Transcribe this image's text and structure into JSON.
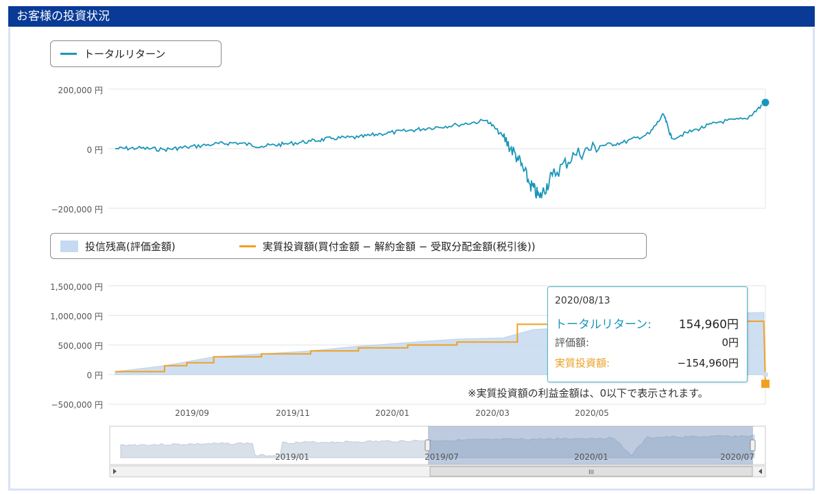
{
  "header": {
    "title": "お客様の投資状況"
  },
  "legend_top": {
    "item": "トータルリターン",
    "color": "#1a96b8"
  },
  "legend_bottom": {
    "item1": "投信残高(評価金額)",
    "item1_color": "#c5daf0",
    "item2": "実質投資額(買付金額 − 解約金額 − 受取分配金額(税引後))",
    "item2_color": "#f0a020"
  },
  "tooltip": {
    "date": "2020/08/13",
    "r1_label": "トータルリターン:",
    "r1_value": "154,960円",
    "r2_label": "評価額:",
    "r2_value": "0円",
    "r3_label": "実質投資額:",
    "r3_value": "−154,960円"
  },
  "note": "※実質投資額の利益金額は、0以下で表示されます。",
  "navigator": {
    "labels": [
      "2019/01",
      "2019/07",
      "2020/01",
      "2020/07"
    ],
    "scroll_grip": "III"
  },
  "chart_data": [
    {
      "type": "line",
      "series": [
        {
          "name": "トータルリターン",
          "x": [
            "2019/07/01",
            "2019/07/15",
            "2019/08/01",
            "2019/08/15",
            "2019/09/01",
            "2019/09/15",
            "2019/10/01",
            "2019/10/15",
            "2019/11/01",
            "2019/11/15",
            "2019/12/01",
            "2019/12/15",
            "2020/01/01",
            "2020/01/15",
            "2020/02/01",
            "2020/02/20",
            "2020/03/01",
            "2020/03/10",
            "2020/03/18",
            "2020/03/24",
            "2020/04/01",
            "2020/04/15",
            "2020/05/01",
            "2020/05/15",
            "2020/06/01",
            "2020/06/10",
            "2020/06/15",
            "2020/07/01",
            "2020/07/15",
            "2020/08/01",
            "2020/08/13"
          ],
          "values": [
            0,
            2000,
            -3000,
            5000,
            15000,
            20000,
            8000,
            15000,
            25000,
            35000,
            38000,
            50000,
            60000,
            70000,
            80000,
            95000,
            40000,
            -30000,
            -120000,
            -165000,
            -90000,
            -20000,
            10000,
            20000,
            50000,
            115000,
            35000,
            65000,
            90000,
            100000,
            154960
          ]
        }
      ],
      "yticks": [
        "200,000 円",
        "0 円",
        "−200,000 円"
      ],
      "ylim": [
        -200000,
        200000
      ]
    },
    {
      "type": "area",
      "series": [
        {
          "name": "投信残高(評価金額)",
          "x": [
            "2019/07/01",
            "2019/08/01",
            "2019/09/01",
            "2019/10/01",
            "2019/11/01",
            "2019/12/01",
            "2020/01/01",
            "2020/02/01",
            "2020/03/01",
            "2020/03/20",
            "2020/04/01",
            "2020/05/01",
            "2020/06/01",
            "2020/07/01",
            "2020/08/01",
            "2020/08/12",
            "2020/08/13"
          ],
          "values": [
            50000,
            150000,
            300000,
            350000,
            400000,
            480000,
            540000,
            600000,
            620000,
            760000,
            780000,
            860000,
            930000,
            1000000,
            1040000,
            1050000,
            0
          ]
        },
        {
          "name": "実質投資額(買付金額 − 解約金額 − 受取分配金額(税引後))",
          "x": [
            "2019/07/01",
            "2019/08/01",
            "2019/08/15",
            "2019/09/01",
            "2019/10/01",
            "2019/11/01",
            "2019/12/01",
            "2020/01/01",
            "2020/02/01",
            "2020/03/01",
            "2020/03/10",
            "2020/04/01",
            "2020/05/01",
            "2020/06/01",
            "2020/07/01",
            "2020/08/12",
            "2020/08/13"
          ],
          "values": [
            50000,
            150000,
            200000,
            300000,
            350000,
            400000,
            450000,
            500000,
            550000,
            550000,
            850000,
            850000,
            880000,
            900000,
            900000,
            900000,
            -154960
          ]
        }
      ],
      "yticks": [
        "1,500,000 円",
        "1,000,000 円",
        "500,000 円",
        "0 円",
        "−500,000 円"
      ],
      "xticks": [
        "2019/09",
        "2019/11",
        "2020/01",
        "2020/03",
        "2020/05"
      ],
      "ylim": [
        -500000,
        1500000
      ]
    }
  ]
}
